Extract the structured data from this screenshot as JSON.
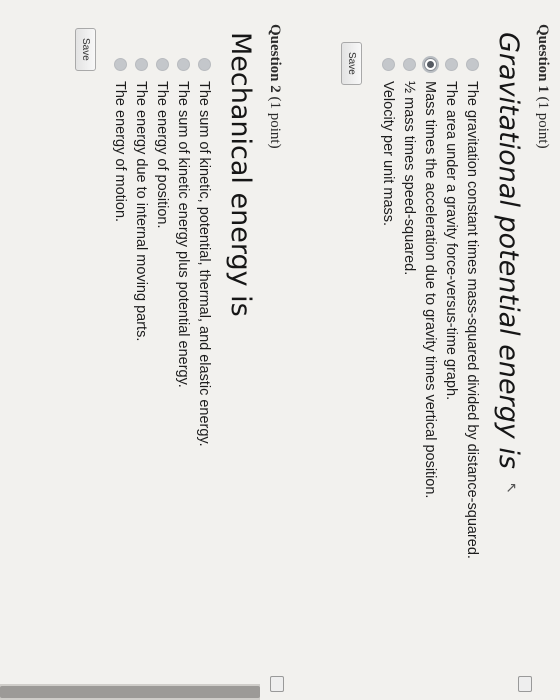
{
  "question1": {
    "label_bold": "Question 1",
    "label_points": "(1 point)",
    "title": "Gravitational potential energy is",
    "options": [
      "The gravitation constant times mass-squared divided by distance-squared.",
      "The area under a gravity force-versus-time graph.",
      "Mass times the acceleration due to gravity times vertical position.",
      "½ mass times speed-squared.",
      "Velocity per unit mass."
    ],
    "selected_index": 2,
    "save_label": "Save"
  },
  "question2": {
    "label_bold": "Question 2",
    "label_points": "(1 point)",
    "title": "Mechanical energy is",
    "options": [
      "The sum of kinetic, potential, thermal, and elastic energy.",
      "The sum of kinetic energy plus potential  energy.",
      "The energy of position.",
      "The energy due to internal moving parts.",
      "The energy of motion."
    ],
    "selected_index": null,
    "save_label": "Save"
  },
  "colors": {
    "page_bg": "#f2f1ee",
    "radio": "#c4c7cb",
    "selected_dot": "#565b63"
  },
  "icons": [
    "cursor-icon",
    "edit-icon",
    "scrollbar"
  ]
}
